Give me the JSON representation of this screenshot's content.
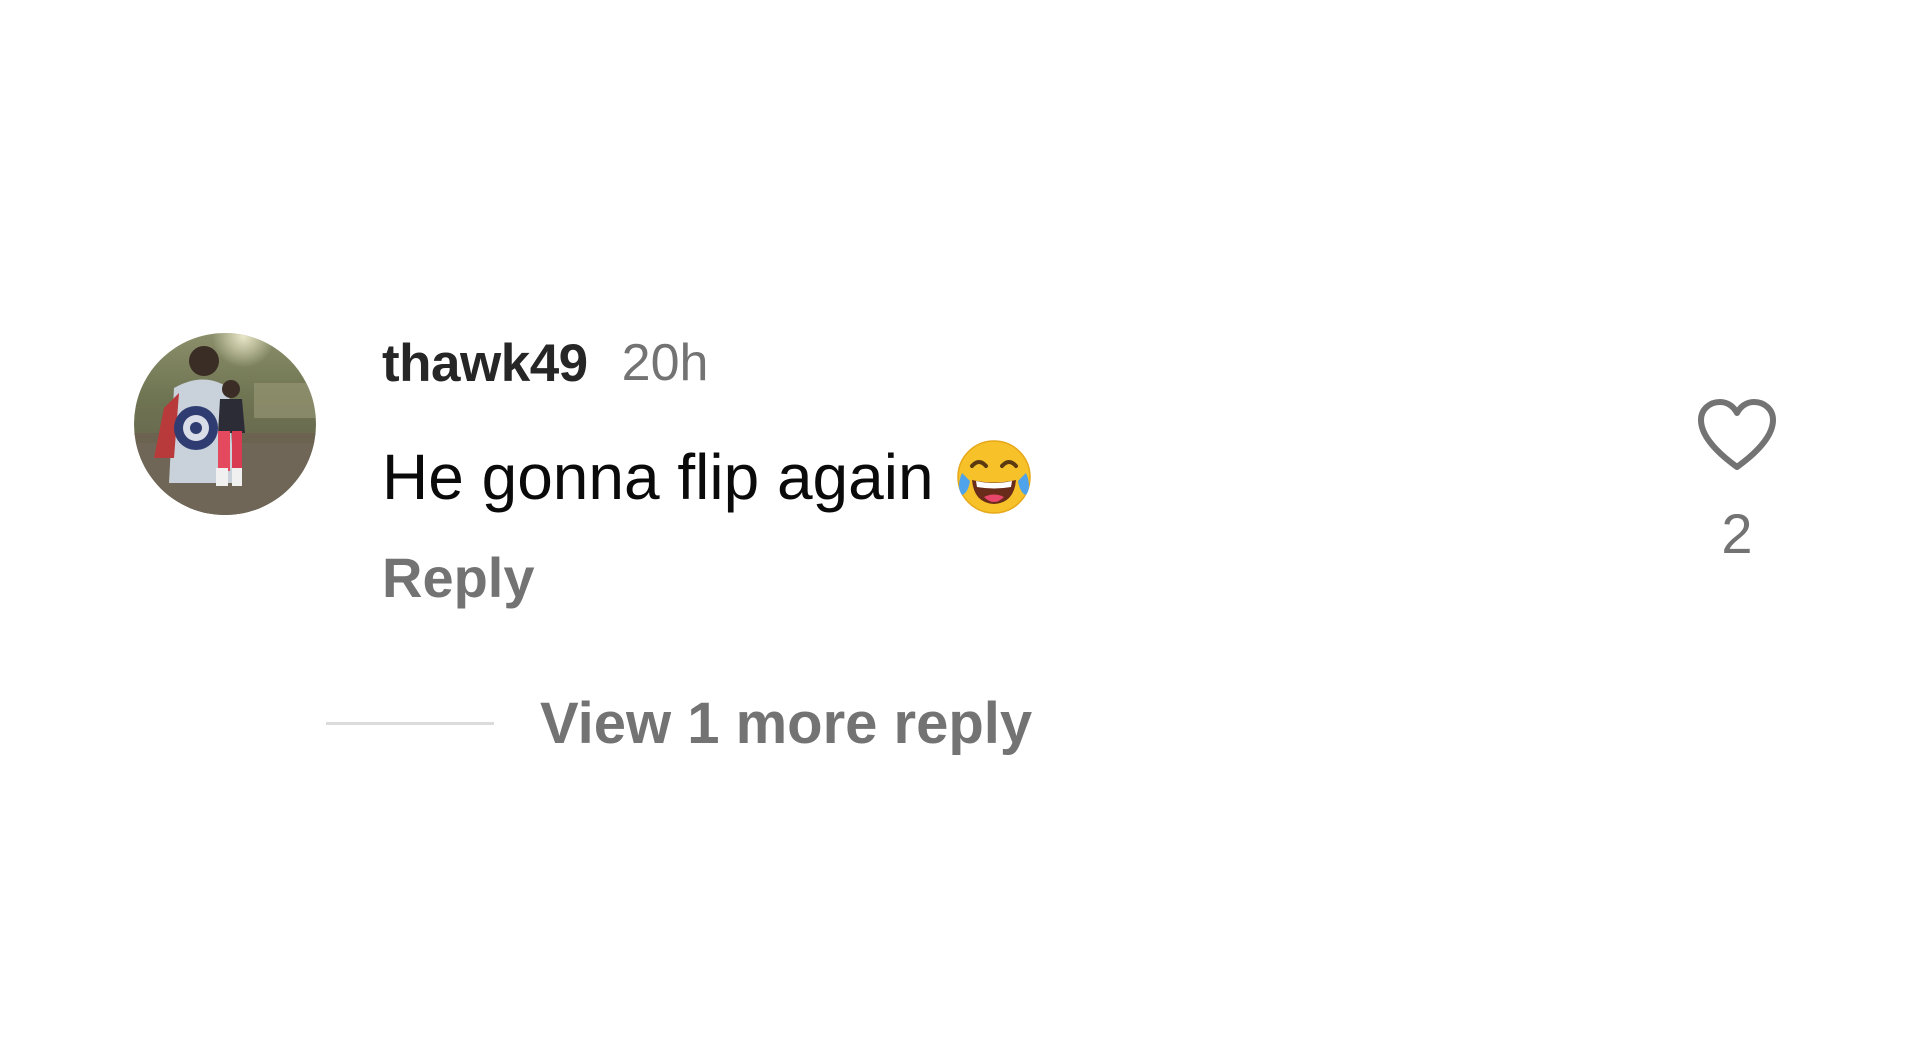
{
  "comment": {
    "username": "thawk49",
    "timestamp": "20h",
    "text": "He gonna flip again",
    "emoji": "face-with-tears-of-joy-icon",
    "reply_label": "Reply",
    "like_count": "2"
  },
  "replies": {
    "view_more_label": "View 1 more reply"
  },
  "colors": {
    "username": "#262626",
    "secondary_text": "#737373",
    "body_text": "#0a0a0a",
    "divider": "#dbdbdb",
    "background": "#ffffff"
  }
}
